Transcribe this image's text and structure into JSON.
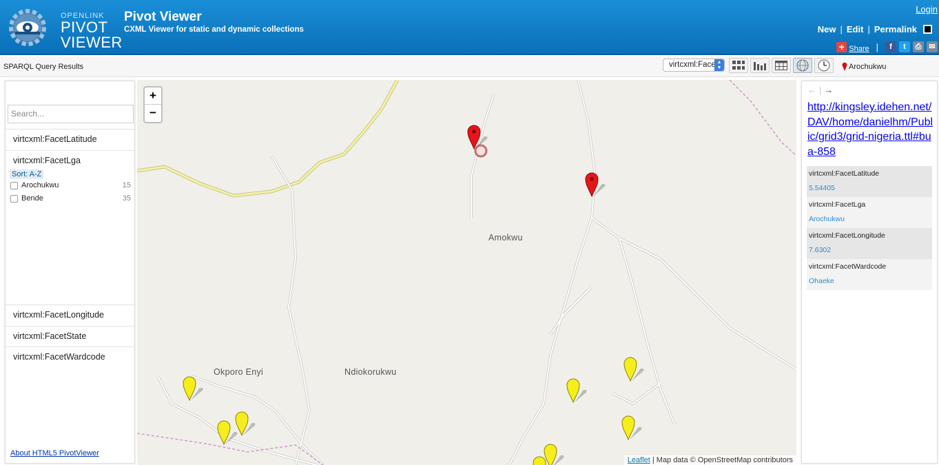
{
  "header": {
    "logo_small": "OPENLINK",
    "logo_line1": "PIVOT",
    "logo_line2": "VIEWER",
    "title": "Pivot Viewer",
    "subtitle": "CXML Viewer for static and dynamic collections",
    "login": "Login",
    "links": [
      "New",
      "Edit",
      "Permalink"
    ],
    "share": "Share",
    "social": [
      {
        "icon": "facebook-icon",
        "glyph": "f",
        "color": "#3b5998"
      },
      {
        "icon": "twitter-icon",
        "glyph": "t",
        "color": "#1da1f2"
      },
      {
        "icon": "print-icon",
        "glyph": "⎙",
        "color": "#7a8a9a"
      },
      {
        "icon": "email-icon",
        "glyph": "✉",
        "color": "#7a8a9a"
      }
    ]
  },
  "toolbar": {
    "results_label": "SPARQL Query Results",
    "sort_value": "virtcxml:FacetLatitude",
    "views": [
      "grid-view",
      "graph-view",
      "table-view",
      "map-view",
      "timeline-view"
    ],
    "active_view": "map-view",
    "filter_crumb": "Arochukwu"
  },
  "left": {
    "search_placeholder": "Search...",
    "facets": {
      "latitude": "virtcxml:FacetLatitude",
      "lga": "virtcxml:FacetLga",
      "longitude": "virtcxml:FacetLongitude",
      "state": "virtcxml:FacetState",
      "wardcode": "virtcxml:FacetWardcode"
    },
    "sort_label": "Sort: A-Z",
    "lga_values": [
      {
        "label": "Arochukwu",
        "count": "15"
      },
      {
        "label": "Bende",
        "count": "35"
      }
    ],
    "about": "About HTML5 PivotViewer"
  },
  "map": {
    "zoom_in": "+",
    "zoom_out": "−",
    "places": [
      "Amokwu",
      "Okporo Enyi",
      "Ndiokorukwu"
    ],
    "attribution_link": "Leaflet",
    "attribution_text": " | Map data © OpenStreetMap contributors",
    "marker_colors": {
      "selected": "#e8141a",
      "other": "#f5ee1c"
    }
  },
  "right": {
    "back": "←",
    "forward": "→",
    "item_link": "http://kingsley.idehen.net/DAV/home/danielhm/Public/grid3/grid-nigeria.ttl#bua-858",
    "details": [
      {
        "name": "virtcxml:FacetLatitude",
        "value": "5.54405"
      },
      {
        "name": "virtcxml:FacetLga",
        "value": "Arochukwu"
      },
      {
        "name": "virtcxml:FacetLongitude",
        "value": "7.6302"
      },
      {
        "name": "virtcxml:FacetWardcode",
        "value": "Ohaeke"
      }
    ]
  }
}
